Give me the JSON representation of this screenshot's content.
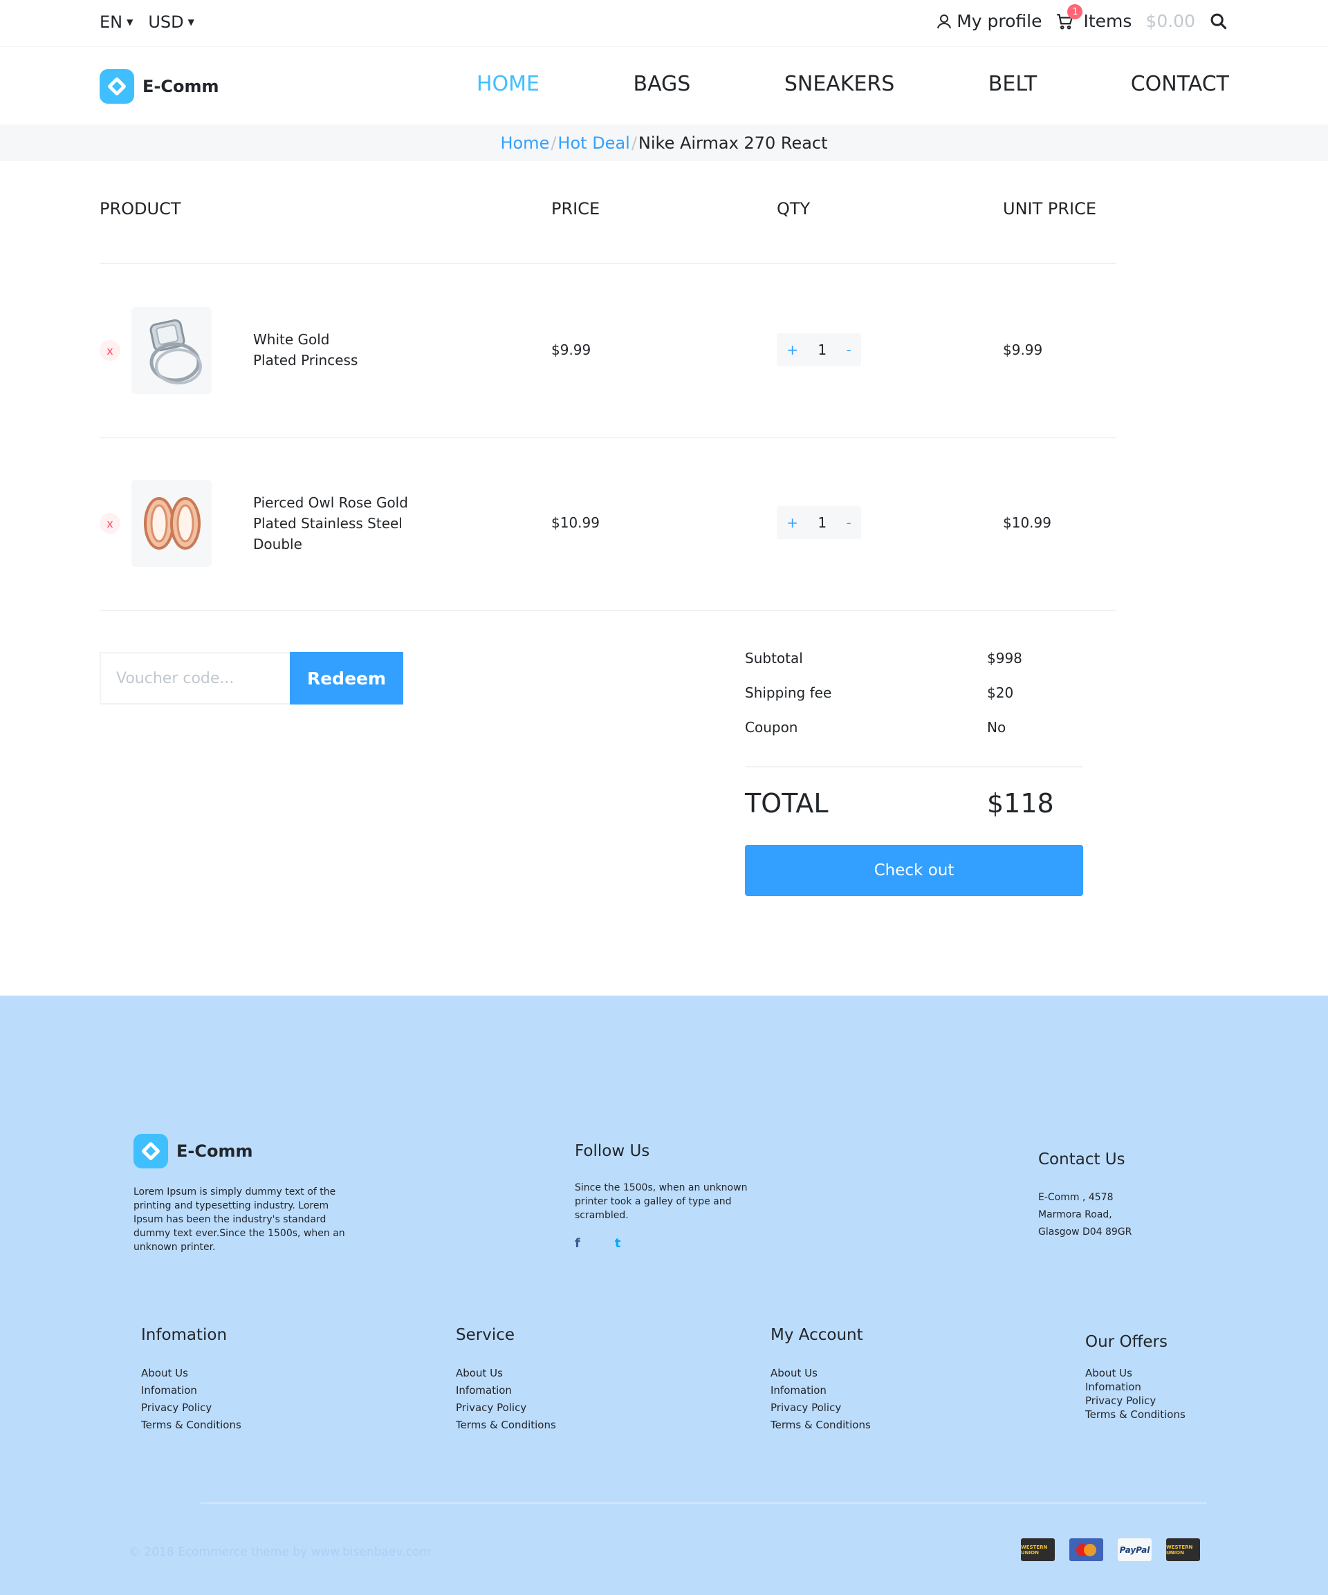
{
  "topbar": {
    "language": "EN",
    "currency": "USD",
    "profile_label": "My profile",
    "cart_count": "1",
    "items_label": "Items",
    "cart_total": "$0.00"
  },
  "brand": {
    "name": "E-Comm"
  },
  "nav": {
    "items": [
      {
        "label": "HOME",
        "active": true
      },
      {
        "label": "BAGS"
      },
      {
        "label": "SNEAKERS"
      },
      {
        "label": "BELT"
      },
      {
        "label": "CONTACT"
      }
    ]
  },
  "breadcrumb": {
    "items": [
      "Home",
      "Hot Deal",
      "Nike Airmax 270 React"
    ],
    "separator": "/"
  },
  "cart": {
    "headers": {
      "product": "PRODUCT",
      "price": "PRICE",
      "qty": "QTY",
      "unit_price": "UNIT PRICE"
    },
    "remove_label": "x",
    "plus": "+",
    "minus": "-",
    "rows": [
      {
        "name_line1": "White Gold",
        "name_line2": "Plated Princess",
        "name_line3": "",
        "price": "$9.99",
        "qty": "1",
        "unit_price": "$9.99",
        "image_icon": "ring-icon"
      },
      {
        "name_line1": "Pierced Owl Rose Gold",
        "name_line2": "Plated Stainless Steel",
        "name_line3": "Double",
        "price": "$10.99",
        "qty": "1",
        "unit_price": "$10.99",
        "image_icon": "tunnel-earrings-icon"
      }
    ]
  },
  "voucher": {
    "placeholder": "Voucher code...",
    "button_label": "Redeem"
  },
  "summary": {
    "subtotal_label": "Subtotal",
    "subtotal": "$998",
    "shipping_label": "Shipping fee",
    "shipping": "$20",
    "coupon_label": "Coupon",
    "coupon": "No",
    "total_label": "TOTAL",
    "total": "$118",
    "checkout_label": "Check out"
  },
  "footer": {
    "brand": "E-Comm",
    "about": "Lorem Ipsum is simply dummy text of the printing and typesetting industry. Lorem Ipsum has been the industry's standard dummy text ever.Since the 1500s, when an unknown printer.",
    "follow_title": "Follow Us",
    "follow_text": "Since the 1500s, when an unknown printer took a galley of type and scrambled.",
    "social": {
      "facebook": "f",
      "twitter": "t"
    },
    "contact_title": "Contact Us",
    "contact_line1": "E-Comm , 4578",
    "contact_line2": "Marmora Road,",
    "contact_line3": "Glasgow D04 89GR",
    "columns": [
      {
        "title": "Infomation",
        "links": [
          "About Us",
          "Infomation",
          "Privacy Policy",
          "Terms & Conditions"
        ]
      },
      {
        "title": "Service",
        "links": [
          "About Us",
          "Infomation",
          "Privacy Policy",
          "Terms & Conditions"
        ]
      },
      {
        "title": "My Account",
        "links": [
          "About Us",
          "Infomation",
          "Privacy Policy",
          "Terms & Conditions"
        ]
      },
      {
        "title": "Our Offers",
        "links": [
          "About Us",
          "Infomation",
          "Privacy Policy",
          "Terms & Conditions"
        ]
      }
    ],
    "copyright": "© 2018 Ecommerce theme by www.bisenbaev.com",
    "payments": {
      "western_union": "WESTERN UNION",
      "mastercard": "MasterCard",
      "paypal": "PayPal",
      "western_union_2": "WESTERN UNION"
    }
  },
  "colors": {
    "accent": "#33a0ff",
    "logo": "#40bfff",
    "footer_bg": "#bcdcfc",
    "badge": "#ff6575"
  }
}
